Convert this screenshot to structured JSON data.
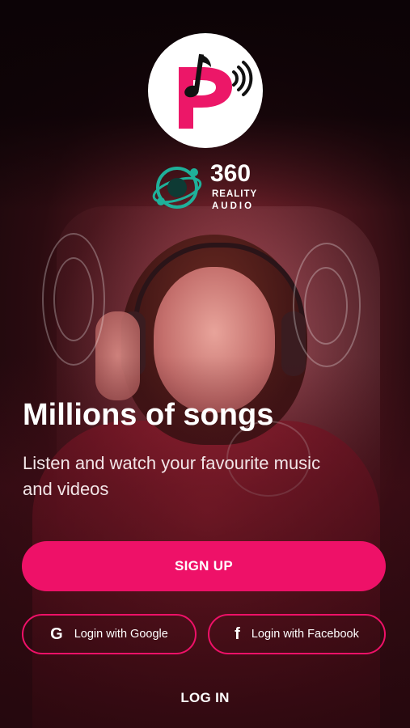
{
  "brand": {
    "logo_icon": "p-music-note-sound-waves-icon",
    "badge_icon": "360-reality-audio-orbit-icon",
    "badge_number": "360",
    "badge_line1": "REALITY",
    "badge_line2": "AUDIO"
  },
  "hero": {
    "headline": "Millions of songs",
    "subtitle": "Listen and watch your favourite music and videos"
  },
  "actions": {
    "signup_label": "SIGN UP",
    "google_label": "Login with Google",
    "google_icon": "google-g-icon",
    "facebook_label": "Login with Facebook",
    "facebook_icon": "facebook-f-icon",
    "login_label": "LOG IN"
  },
  "colors": {
    "accent": "#ee1168",
    "logo_pink": "#ec1768",
    "badge_teal": "#1fb09a",
    "text": "#ffffff"
  }
}
